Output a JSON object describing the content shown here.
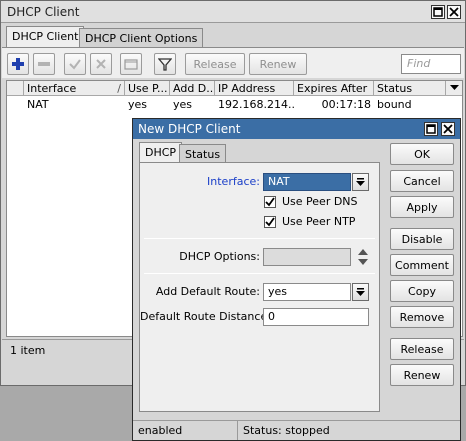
{
  "main_window": {
    "title": "DHCP Client",
    "tabs": [
      {
        "label": "DHCP Client"
      },
      {
        "label": "DHCP Client Options"
      }
    ],
    "toolbar": {
      "add_icon": "plus-icon",
      "remove_icon": "minus-icon",
      "enable_icon": "check-icon",
      "disable_icon": "x-icon",
      "comment_icon": "comment-icon",
      "filter_icon": "filter-icon",
      "release_label": "Release",
      "renew_label": "Renew",
      "find_placeholder": "Find"
    },
    "table": {
      "columns": [
        "Interface",
        "Use P...",
        "Add D...",
        "IP Address",
        "Expires After",
        "Status"
      ],
      "rows": [
        {
          "interface": "NAT",
          "use_peer": "yes",
          "add_default": "yes",
          "ip_address": "192.168.214....",
          "expires_after": "00:17:18",
          "status": "bound"
        }
      ]
    },
    "status_text": "1 item"
  },
  "dialog": {
    "title": "New DHCP Client",
    "tabs": [
      {
        "label": "DHCP"
      },
      {
        "label": "Status"
      }
    ],
    "form": {
      "interface_label": "Interface:",
      "interface_value": "NAT",
      "use_peer_dns_label": "Use Peer DNS",
      "use_peer_dns_checked": true,
      "use_peer_ntp_label": "Use Peer NTP",
      "use_peer_ntp_checked": true,
      "dhcp_options_label": "DHCP Options:",
      "dhcp_options_value": "",
      "add_default_route_label": "Add Default Route:",
      "add_default_route_value": "yes",
      "default_route_distance_label": "Default Route Distance:",
      "default_route_distance_value": "0"
    },
    "buttons": {
      "ok": "OK",
      "cancel": "Cancel",
      "apply": "Apply",
      "disable": "Disable",
      "comment": "Comment",
      "copy": "Copy",
      "remove": "Remove",
      "release": "Release",
      "renew": "Renew"
    },
    "status": {
      "state": "enabled",
      "status": "Status: stopped"
    }
  },
  "colors": {
    "accent_blue": "#1a3ec8",
    "dialog_titlebar": "#3b6ea5",
    "add_icon": "#1f3fae"
  }
}
